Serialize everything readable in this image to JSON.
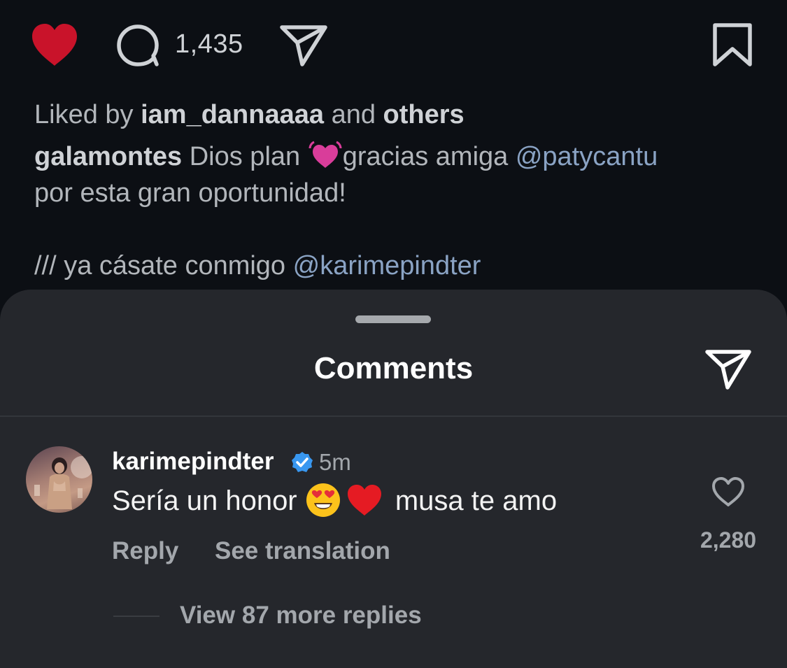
{
  "post": {
    "comment_count": "1,435",
    "liked_by_prefix": "Liked by ",
    "liked_by_user": "iam_dannaaaa",
    "liked_by_middle": " and ",
    "liked_by_suffix": "others",
    "caption_user": "galamontes",
    "caption_text_1": " Dios plan ",
    "caption_text_2": "gracias amiga ",
    "caption_mention_1": "@patycantu",
    "caption_line_2": "por esta gran oportunidad!",
    "caption_line_3_prefix": "/// ya cásate conmigo ",
    "caption_mention_2": "@karimepindter",
    "icons": [
      "heart-filled-icon",
      "comment-icon",
      "share-icon",
      "bookmark-icon",
      "growing-heart-emoji"
    ]
  },
  "sheet": {
    "title": "Comments",
    "share_icon": "share-icon"
  },
  "comment": {
    "username": "karimepindter",
    "verified_icon": "verified-badge-icon",
    "time_ago": "5m",
    "text_before": "Sería un honor ",
    "text_after": " musa te amo",
    "emojis": [
      "heart-eyes-emoji",
      "red-heart-emoji"
    ],
    "reply_label": "Reply",
    "translate_label": "See translation",
    "like_count": "2,280",
    "view_replies_label": "View 87 more replies"
  },
  "colors": {
    "background": "#0c0f14",
    "sheet": "#25272c",
    "like_red": "#c9132a",
    "mention_blue": "#8aa3c4",
    "verified_blue": "#3897f0"
  }
}
